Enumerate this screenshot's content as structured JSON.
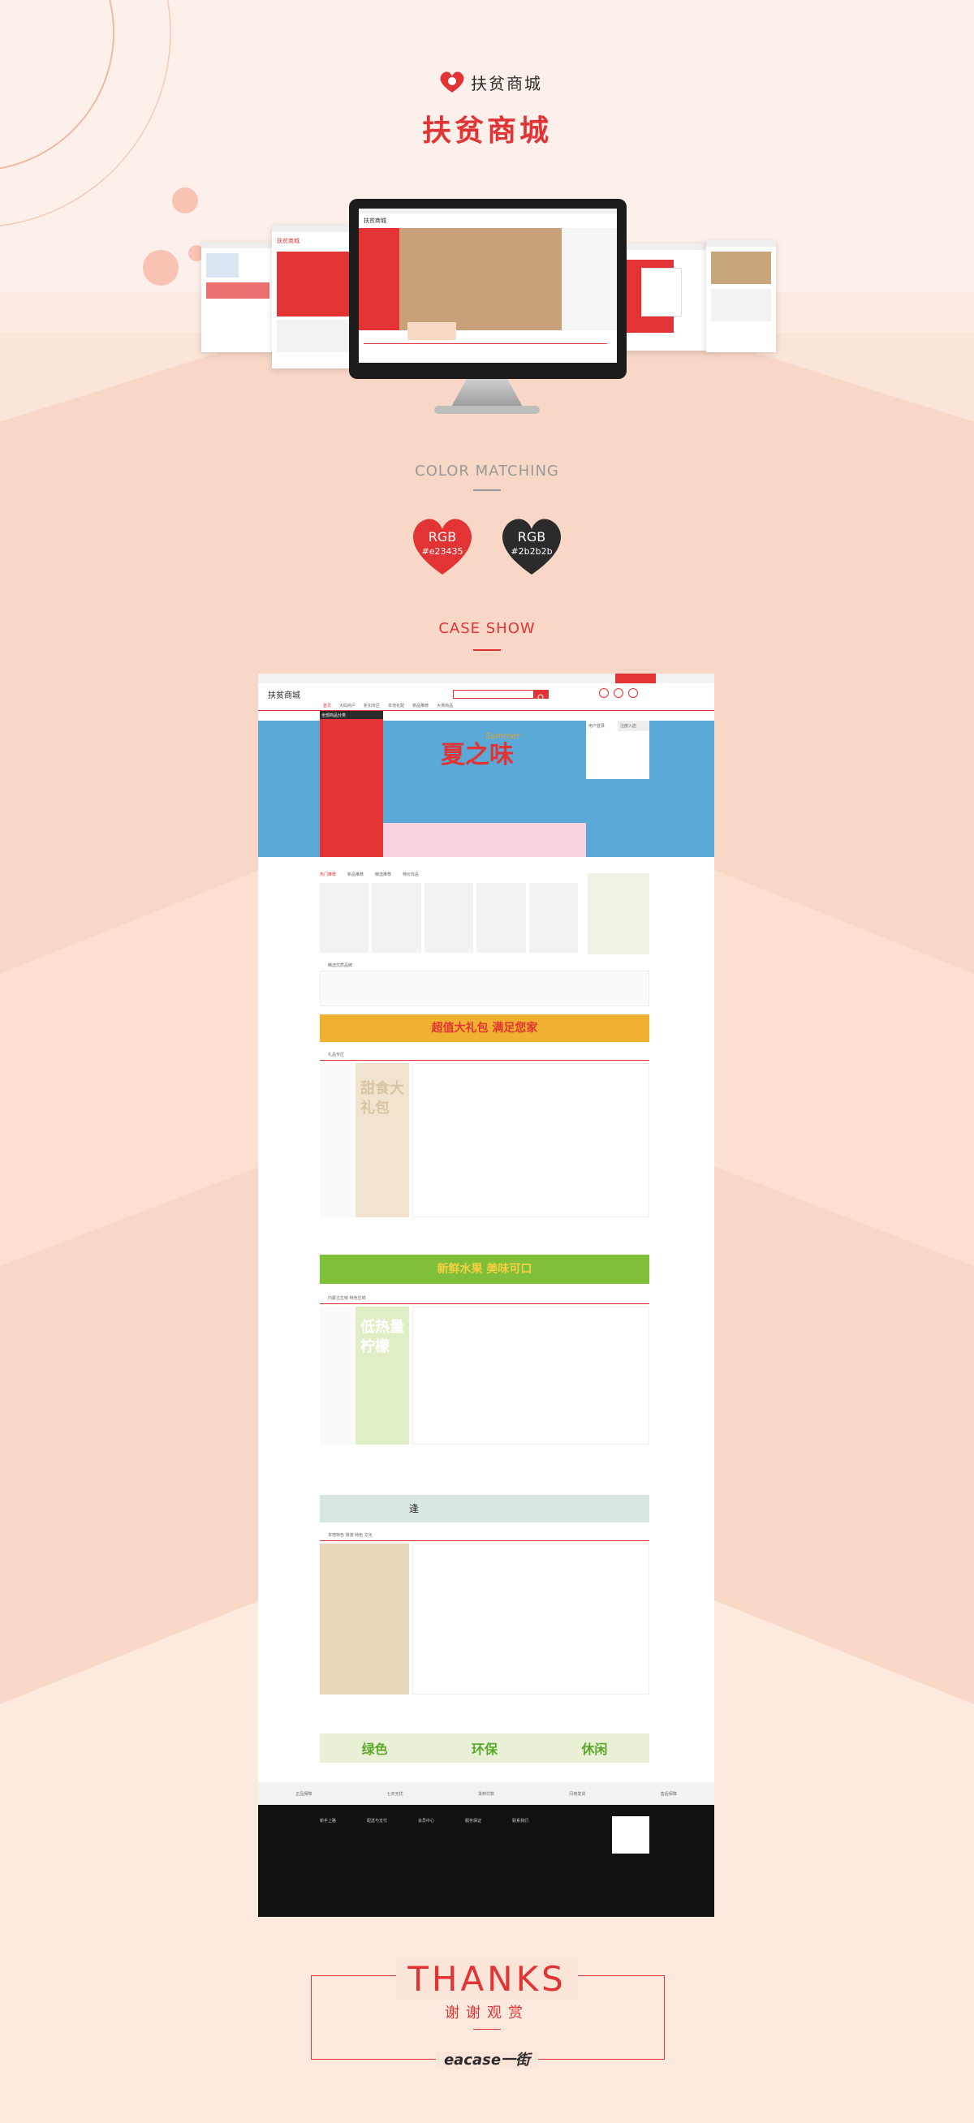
{
  "brand": {
    "logo_text": "扶贫商城",
    "title": "扶贫商城"
  },
  "color_matching": {
    "label": "COLOR MATCHING",
    "swatches": [
      {
        "name": "RGB",
        "hex_label": "#e23435",
        "color": "#e23435"
      },
      {
        "name": "RGB",
        "hex_label": "#2b2b2b",
        "color": "#2b2b2b"
      }
    ]
  },
  "case_show": {
    "label": "CASE SHOW",
    "site": {
      "logo_text": "扶贫商城",
      "search_placeholder": "",
      "nav": [
        "首页",
        "大码商户",
        "折扣专区",
        "本地化配",
        "新品推荐",
        "大类商品"
      ],
      "category_header": "全部商品分类",
      "banner_title": "夏之味",
      "banner_script": "Summer",
      "login_tabs": [
        "用户登录",
        "注册入店"
      ],
      "hot_tabs": [
        "热门推荐",
        "新品推荐",
        "精选推荐",
        "特价商品"
      ],
      "brand_section_title": "精选优质品牌",
      "promo_banner_1": "超值大礼包 满足您家",
      "floor1_title": "礼品专区",
      "floor1_ad_text": "甜食大礼包",
      "promo_banner_2": "新鲜水果 美味可口",
      "floor2_title": "内蒙古生鲜 特色生鲜",
      "floor2_ad_text": "低热量柠檬",
      "promo_banner_3": "逢",
      "floor3_title": "本地特色 旅游 特色 文化",
      "promo_banner_4": [
        "绿色",
        "环保",
        "休闲"
      ],
      "service_items": [
        "正品保障",
        "七天无忧",
        "货到付款",
        "闪电发货",
        "售后保障"
      ],
      "footer_columns": [
        "新手上路",
        "配送与支付",
        "会员中心",
        "服务保证",
        "联系我们"
      ]
    }
  },
  "thanks": {
    "title": "THANKS",
    "subtitle": "谢谢观赏",
    "signature": "eacase一街"
  }
}
